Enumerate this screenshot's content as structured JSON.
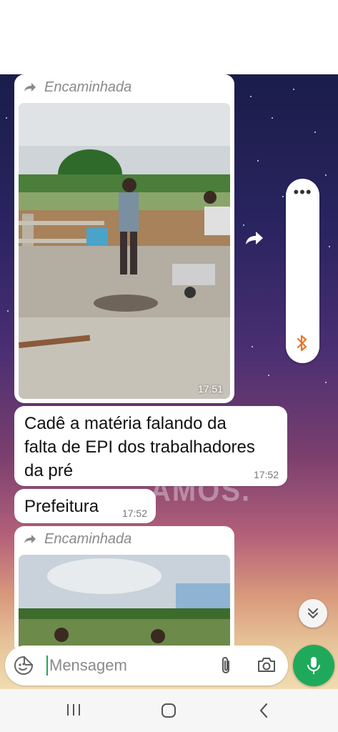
{
  "messages": [
    {
      "forwarded_label": "Encaminhada",
      "type": "image",
      "time": "17:51"
    },
    {
      "type": "text",
      "text_lines": [
        "Cadê a matéria falando da",
        "falta de EPI dos trabalhadores",
        "da pré"
      ],
      "time": "17:52"
    },
    {
      "type": "text",
      "text_lines": [
        "Prefeitura"
      ],
      "time": "17:52"
    },
    {
      "forwarded_label": "Encaminhada",
      "type": "image"
    }
  ],
  "wallpaper_text": "AMOS.",
  "composer": {
    "placeholder": "Mensagem"
  },
  "icons": {
    "forward": "forward-icon",
    "menu": "more-dots-icon",
    "bluetooth": "bluetooth-icon",
    "scroll": "double-chevron-down-icon",
    "emoji": "sticker-icon",
    "attach": "paperclip-icon",
    "camera": "camera-icon",
    "mic": "microphone-icon",
    "nav_recent": "recent-apps-icon",
    "nav_home": "home-icon",
    "nav_back": "back-icon"
  },
  "colors": {
    "accent": "#1faa5b",
    "bluetooth": "#e8732b",
    "bubble": "#ffffff"
  }
}
